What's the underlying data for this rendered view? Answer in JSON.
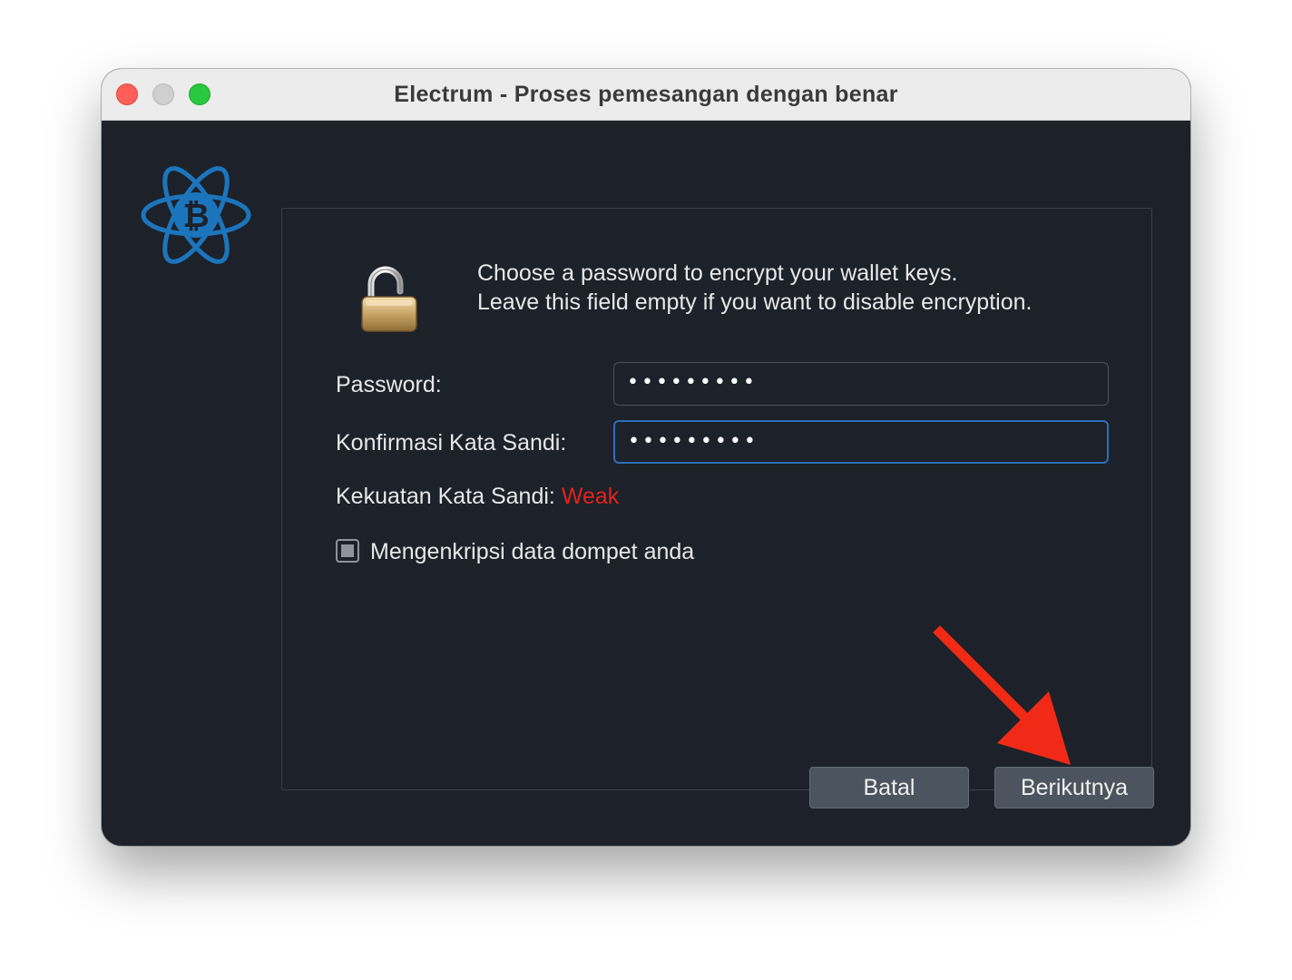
{
  "window": {
    "title": "Electrum  -  Proses pemesangan dengan benar"
  },
  "dialog": {
    "message_line1": "Choose a password to encrypt your wallet keys.",
    "message_line2": "Leave this field empty if you want to disable encryption.",
    "password_label": "Password:",
    "password_value": "•••••••••",
    "confirm_label": "Konfirmasi Kata Sandi:",
    "confirm_value": "•••••••••",
    "strength_label": "Kekuatan Kata Sandi:",
    "strength_value": "Weak",
    "encrypt_checkbox_label": "Mengenkripsi data dompet anda",
    "encrypt_checkbox_state": "partial"
  },
  "buttons": {
    "cancel_label": "Batal",
    "next_label": "Berikutnya"
  },
  "icons": {
    "logo": "electrum-bitcoin-logo-icon",
    "lock": "unlocked-padlock-icon",
    "annotation": "red-arrow-annotation"
  },
  "colors": {
    "window_bg": "#1c212a",
    "accent_blue": "#1c75bc",
    "focus_border": "#2f6fb6",
    "weak_red": "#e2231a",
    "annotation_red": "#f02a17"
  }
}
